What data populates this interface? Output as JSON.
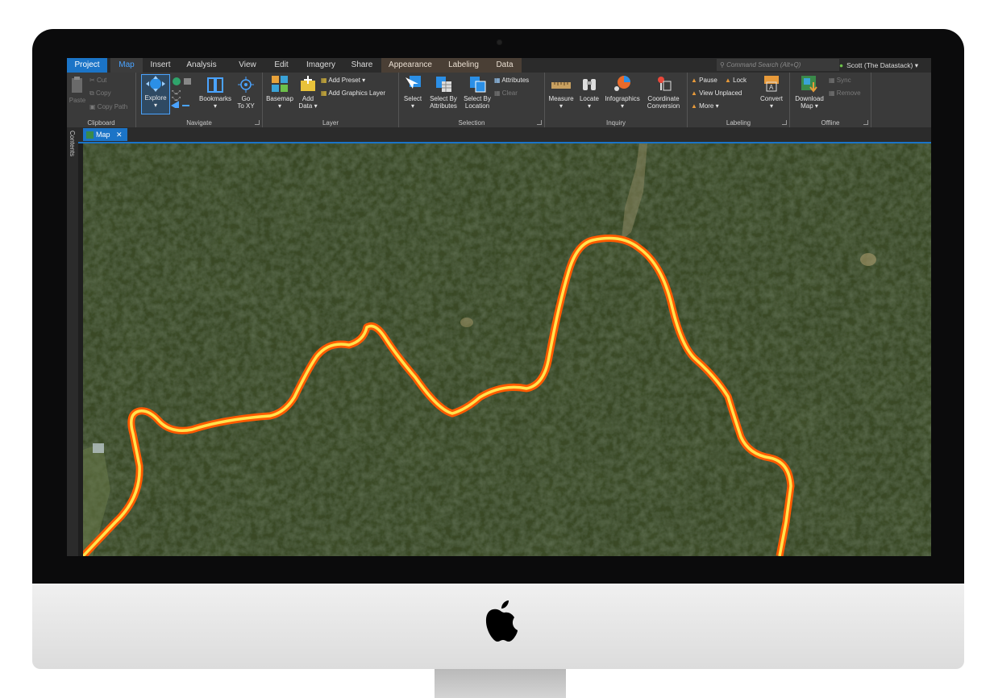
{
  "tabs": [
    "Project",
    "Map",
    "Insert",
    "Analysis",
    "View",
    "Edit",
    "Imagery",
    "Share",
    "Appearance",
    "Labeling",
    "Data"
  ],
  "command_search_placeholder": "Command Search (Alt+Q)",
  "user": "Scott (The Datastack)",
  "ribbon": {
    "clipboard": {
      "paste": "Paste",
      "cut": "Cut",
      "copy": "Copy",
      "copy_path": "Copy Path",
      "label": "Clipboard"
    },
    "navigate": {
      "explore": "Explore",
      "bookmarks": "Bookmarks",
      "goto": "Go",
      "goto2": "To XY",
      "label": "Navigate"
    },
    "layer": {
      "basemap": "Basemap",
      "add_data": "Add",
      "add_data2": "Data",
      "add_preset": "Add Preset",
      "add_graphics": "Add Graphics Layer",
      "label": "Layer"
    },
    "selection": {
      "select": "Select",
      "by_attr": "Select By",
      "by_attr2": "Attributes",
      "by_loc": "Select By",
      "by_loc2": "Location",
      "attributes": "Attributes",
      "clear": "Clear",
      "label": "Selection"
    },
    "inquiry": {
      "measure": "Measure",
      "locate": "Locate",
      "infographics": "Infographics",
      "coord": "Coordinate",
      "coord2": "Conversion",
      "label": "Inquiry"
    },
    "labeling": {
      "pause": "Pause",
      "lock": "Lock",
      "view_unplaced": "View Unplaced",
      "more": "More",
      "convert": "Convert",
      "label": "Labeling"
    },
    "offline": {
      "download": "Download",
      "download2": "Map",
      "sync": "Sync",
      "remove": "Remove",
      "label": "Offline"
    }
  },
  "side_panel": "Contents",
  "view_tab": "Map",
  "colors": {
    "accent": "#1b74c7",
    "route_outer": "#ff7a00",
    "route_inner": "#ffe34d",
    "forest": "#2e3b1f"
  }
}
